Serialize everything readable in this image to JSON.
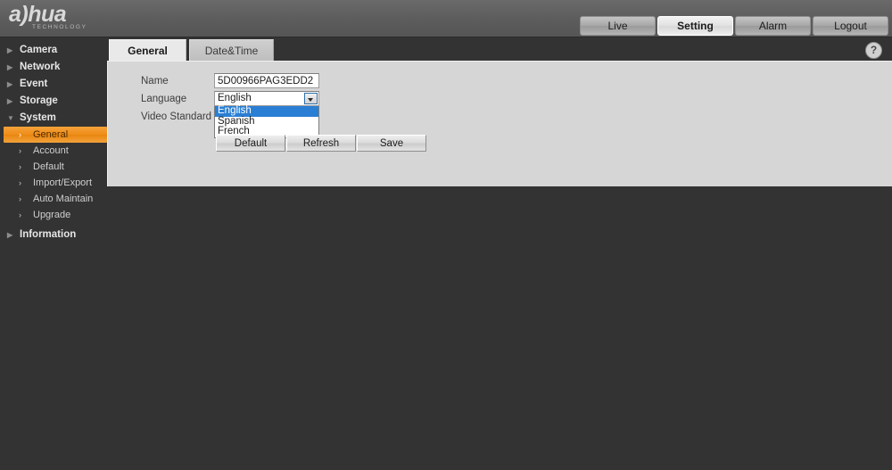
{
  "header": {
    "logo_mark": "a)hua",
    "logo_sub": "TECHNOLOGY",
    "nav": [
      {
        "label": "Live",
        "active": false
      },
      {
        "label": "Setting",
        "active": true
      },
      {
        "label": "Alarm",
        "active": false
      },
      {
        "label": "Logout",
        "active": false
      }
    ]
  },
  "sidebar": {
    "items": [
      {
        "label": "Camera",
        "arrow": "▶"
      },
      {
        "label": "Network",
        "arrow": "▶"
      },
      {
        "label": "Event",
        "arrow": "▶"
      },
      {
        "label": "Storage",
        "arrow": "▶"
      },
      {
        "label": "System",
        "arrow": "▼"
      }
    ],
    "system_children": [
      {
        "label": "General",
        "arrow": "›",
        "selected": true
      },
      {
        "label": "Account",
        "arrow": "›",
        "selected": false
      },
      {
        "label": "Default",
        "arrow": "›",
        "selected": false
      },
      {
        "label": "Import/Export",
        "arrow": "›",
        "selected": false
      },
      {
        "label": "Auto Maintain",
        "arrow": "›",
        "selected": false
      },
      {
        "label": "Upgrade",
        "arrow": "›",
        "selected": false
      }
    ],
    "information": {
      "label": "Information",
      "arrow": "▶"
    }
  },
  "tabs": [
    {
      "label": "General",
      "active": true
    },
    {
      "label": "Date&Time",
      "active": false
    }
  ],
  "help": {
    "glyph": "?",
    "icon": "help-question-icon"
  },
  "form": {
    "labels": {
      "name": "Name",
      "language": "Language",
      "video_standard": "Video Standard"
    },
    "name": {
      "value": "5D00966PAG3EDD2",
      "placeholder": ""
    },
    "language": {
      "selected": "English",
      "expanded": true,
      "options": [
        {
          "label": "English",
          "highlighted": true
        },
        {
          "label": "Spanish",
          "highlighted": false
        },
        {
          "label": "French",
          "highlighted": false
        }
      ]
    }
  },
  "buttons": {
    "default": "Default",
    "refresh": "Refresh",
    "save": "Save"
  },
  "colors": {
    "accent": "#ef8c18",
    "select_highlight": "#2a7fd4",
    "header_bg": "#5d5d5d",
    "body_bg": "#333333",
    "panel_bg": "#d6d6d6"
  }
}
